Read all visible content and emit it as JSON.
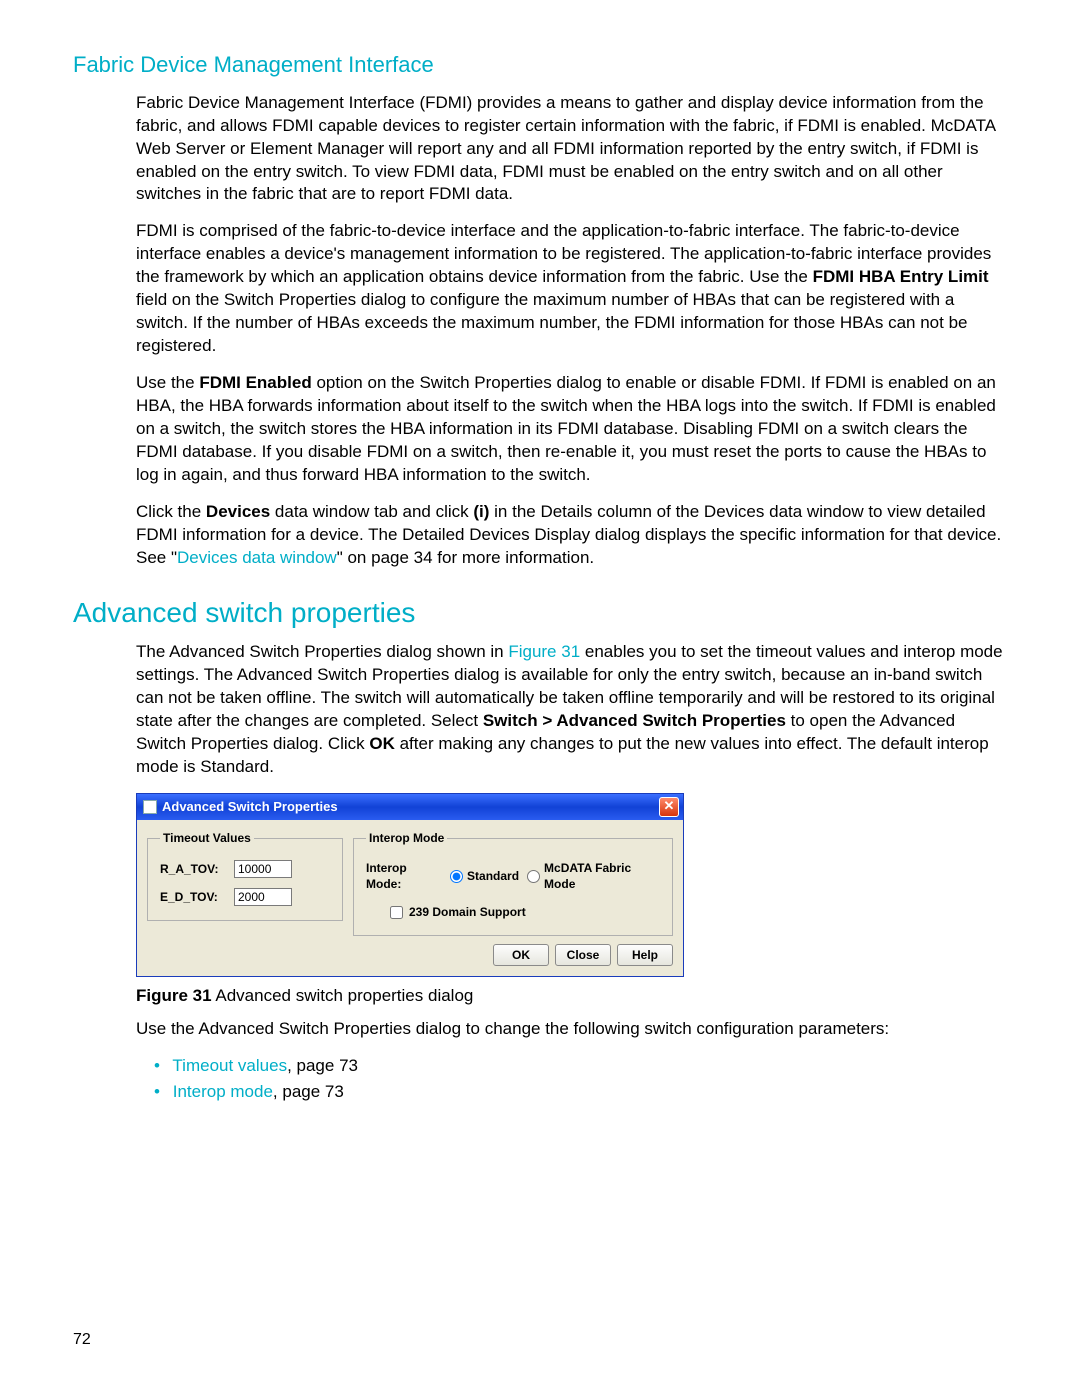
{
  "section1": {
    "heading": "Fabric Device Management Interface",
    "p1": "Fabric Device Management Interface (FDMI) provides a means to gather and display device information from the fabric, and allows FDMI capable devices to register certain information with the fabric, if FDMI is enabled. McDATA Web Server or Element Manager will report any and all FDMI information reported by the entry switch, if FDMI is enabled on the entry switch. To view FDMI data, FDMI must be enabled on the entry switch and on all other switches in the fabric that are to report FDMI data.",
    "p2_pre": "FDMI is comprised of the fabric-to-device interface and the application-to-fabric interface. The fabric-to-device interface enables a device's management information to be registered. The application-to-fabric interface provides the framework by which an application obtains device information from the fabric. Use the ",
    "p2_bold": "FDMI HBA Entry Limit",
    "p2_post": " field on the Switch Properties dialog to configure the maximum number of HBAs that can be registered with a switch. If the number of HBAs exceeds the maximum number, the FDMI information for those HBAs can not be registered.",
    "p3_pre": "Use the ",
    "p3_bold": "FDMI Enabled",
    "p3_post": " option on the Switch Properties dialog to enable or disable FDMI. If FDMI is enabled on an HBA, the HBA forwards information about itself to the switch when the HBA logs into the switch. If FDMI is enabled on a switch, the switch stores the HBA information in its FDMI database. Disabling FDMI on a switch clears the FDMI database. If you disable FDMI on a switch, then re-enable it, you must reset the ports to cause the HBAs to log in again, and thus forward HBA information to the switch.",
    "p4_a": "Click the ",
    "p4_b": "Devices",
    "p4_c": " data window tab and click ",
    "p4_d": "(i)",
    "p4_e": " in the Details column of the Devices data window to view detailed FDMI information for a device. The Detailed Devices Display dialog displays the specific information for that device. See \"",
    "p4_link": "Devices data window",
    "p4_f": "\" on page 34 for more information."
  },
  "section2": {
    "heading": "Advanced switch properties",
    "p1_a": "The Advanced Switch Properties dialog shown in ",
    "p1_link": "Figure 31",
    "p1_b": " enables you to set the timeout values and interop mode settings. The Advanced Switch Properties dialog is available for only the entry switch, because an in-band switch can not be taken offline. The switch will automatically be taken offline temporarily and will be restored to its original state after the changes are completed. Select ",
    "p1_bold1": "Switch > Advanced Switch Properties",
    "p1_c": " to open the Advanced Switch Properties dialog. Click ",
    "p1_bold2": "OK",
    "p1_d": " after making any changes to put the new values into effect. The default interop mode is Standard.",
    "figcap_b": "Figure 31",
    "figcap_t": "  Advanced switch properties dialog",
    "p_after": "Use the Advanced Switch Properties dialog to change the following switch configuration parameters:",
    "bullets": [
      {
        "link": "Timeout values",
        "rest": ", page 73"
      },
      {
        "link": "Interop mode",
        "rest": ", page 73"
      }
    ]
  },
  "dialog": {
    "title": "Advanced Switch Properties",
    "timeout_legend": "Timeout Values",
    "ra_label": "R_A_TOV:",
    "ra_value": "10000",
    "ed_label": "E_D_TOV:",
    "ed_value": "2000",
    "interop_legend": "Interop Mode",
    "mode_label": "Interop Mode:",
    "opt_standard": "Standard",
    "opt_mcdata": "McDATA Fabric Mode",
    "cb_239": "239 Domain Support",
    "btn_ok": "OK",
    "btn_close": "Close",
    "btn_help": "Help"
  },
  "pagenum": "72"
}
